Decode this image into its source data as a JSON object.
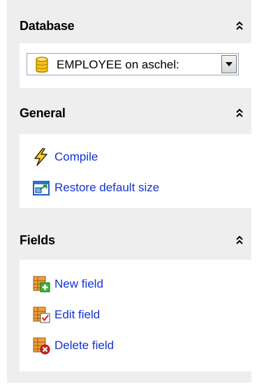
{
  "sections": {
    "database": {
      "title": "Database",
      "selected_database": "EMPLOYEE on aschel:",
      "icons": {
        "header_toggle": "collapse-chevrons-icon",
        "db": "database-cylinder-icon",
        "dropdown": "dropdown-arrow-icon"
      }
    },
    "general": {
      "title": "General",
      "items": [
        {
          "label": "Compile",
          "icon": "lightning-compile-icon"
        },
        {
          "label": "Restore default size",
          "icon": "restore-size-icon"
        }
      ]
    },
    "fields": {
      "title": "Fields",
      "items": [
        {
          "label": "New field",
          "icon": "new-field-icon"
        },
        {
          "label": "Edit field",
          "icon": "edit-field-icon"
        },
        {
          "label": "Delete field",
          "icon": "delete-field-icon"
        }
      ]
    }
  },
  "colors": {
    "panel_bg": "#eeeeee",
    "link": "#1533cf",
    "db_yellow": "#f5c518"
  }
}
